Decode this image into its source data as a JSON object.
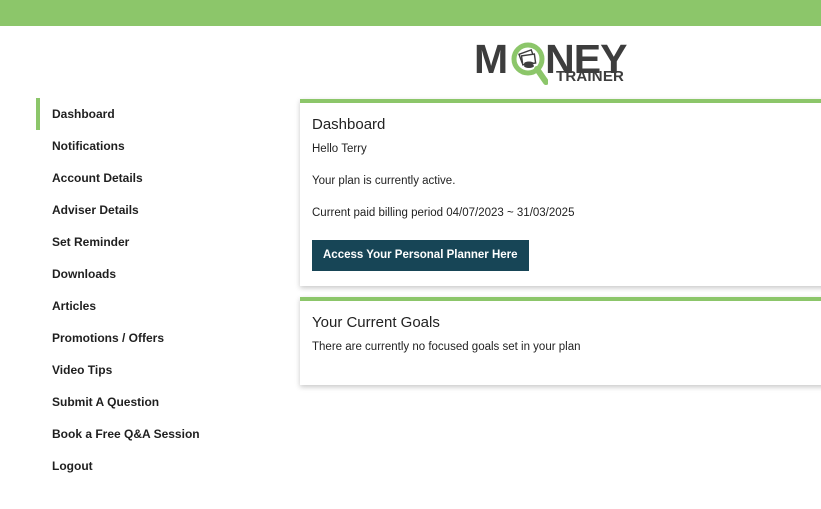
{
  "brand": {
    "logo_word": "M  NEY",
    "logo_sub": "TRAINER",
    "accent": "#8cc66a",
    "button_color": "#174556"
  },
  "sidebar": {
    "items": [
      {
        "label": "Dashboard",
        "active": true
      },
      {
        "label": "Notifications"
      },
      {
        "label": "Account Details"
      },
      {
        "label": "Adviser Details"
      },
      {
        "label": "Set Reminder"
      },
      {
        "label": "Downloads"
      },
      {
        "label": "Articles"
      },
      {
        "label": "Promotions / Offers"
      },
      {
        "label": "Video Tips"
      },
      {
        "label": "Submit A Question"
      },
      {
        "label": "Book a Free Q&A Session"
      },
      {
        "label": "Logout"
      }
    ]
  },
  "dashboard": {
    "title": "Dashboard",
    "greeting": "Hello Terry",
    "plan_status": "Your plan is currently active.",
    "billing_period": "Current paid billing period 04/07/2023 ~ 31/03/2025",
    "planner_button": "Access Your Personal Planner Here"
  },
  "goals": {
    "title": "Your Current Goals",
    "message": "There are currently no focused goals set in your plan"
  }
}
